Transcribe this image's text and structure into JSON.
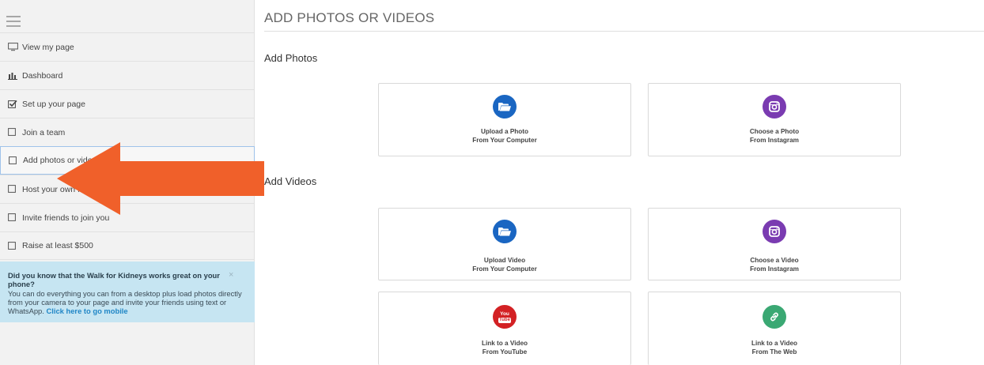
{
  "sidebar": {
    "menu_icon": "hamburger-icon",
    "items": [
      {
        "label": "View my page",
        "icon": "monitor-icon"
      },
      {
        "label": "Dashboard",
        "icon": "bar-chart-icon"
      },
      {
        "label": "Set up your page",
        "icon": "checked-box-icon"
      },
      {
        "label": "Join a team",
        "icon": "checkbox-icon"
      },
      {
        "label": "Add photos or videos",
        "icon": "checkbox-icon"
      },
      {
        "label": "Host your own fundraising",
        "icon": "checkbox-icon"
      },
      {
        "label": "Invite friends to join you",
        "icon": "checkbox-icon"
      },
      {
        "label": "Raise at least $500",
        "icon": "checkbox-icon"
      }
    ],
    "info": {
      "heading": "Did you know that the Walk for Kidneys works great on your phone?",
      "body": "You can do everything you can from a desktop plus load photos directly from your camera to your page and invite your friends using text or WhatsApp.",
      "link": "Click here to go mobile",
      "close": "×"
    }
  },
  "main": {
    "title": "ADD PHOTOS OR VIDEOS",
    "photos_label": "Add Photos",
    "videos_label": "Add Videos",
    "photo_cards": [
      {
        "line1": "Upload a Photo",
        "line2": "From Your Computer",
        "icon": "folder-icon",
        "color": "#1a66c2"
      },
      {
        "line1": "Choose a Photo",
        "line2": "From Instagram",
        "icon": "instagram-icon",
        "color": "#7a3bb1"
      }
    ],
    "video_cards": [
      {
        "line1": "Upload Video",
        "line2": "From Your Computer",
        "icon": "folder-icon",
        "color": "#1a66c2"
      },
      {
        "line1": "Choose a Video",
        "line2": "From Instagram",
        "icon": "instagram-icon",
        "color": "#7a3bb1"
      },
      {
        "line1": "Link to a Video",
        "line2": "From YouTube",
        "icon": "youtube-icon",
        "color": "#d32124",
        "glyph_top": "You",
        "glyph_bottom": "Tube"
      },
      {
        "line1": "Link to a Video",
        "line2": "From The Web",
        "icon": "link-icon",
        "color": "#3aa873"
      }
    ]
  },
  "colors": {
    "arrow": "#f0602a",
    "info_bg": "#c6e5f2",
    "active_border": "#9fc3ea"
  }
}
